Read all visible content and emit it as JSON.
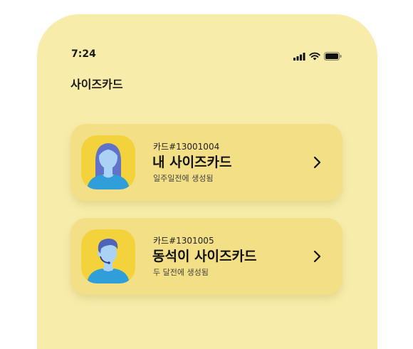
{
  "status_bar": {
    "time": "7:24"
  },
  "page": {
    "title": "사이즈카드"
  },
  "cards": [
    {
      "code": "카드#13001004",
      "title": "내 사이즈카드",
      "subtitle": "일주일전에 생성됨",
      "avatar": "female-avatar"
    },
    {
      "code": "카드#1301005",
      "title": "동석이 사이즈카드",
      "subtitle": "두 달전에 생성됨",
      "avatar": "male-avatar"
    }
  ],
  "colors": {
    "phone_bg": "#f7ecaa",
    "card_bg": "#f3df85",
    "avatar_bg": "#f3d23c",
    "avatar_skin": "#a9d2f5",
    "shirt": "#2f9ed9",
    "female_hair": "#6072c9",
    "male_hair": "#4d64b8"
  }
}
